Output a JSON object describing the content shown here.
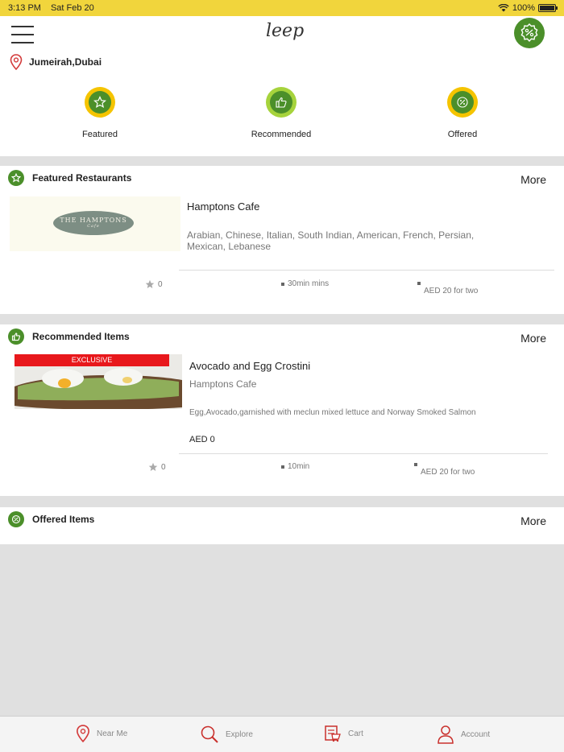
{
  "status": {
    "time": "3:13 PM",
    "date": "Sat Feb 20",
    "battery": "100%",
    "battery_level": 1.0
  },
  "app": {
    "logo": "leep"
  },
  "location": {
    "name": "Jumeirah,Dubai"
  },
  "categories": [
    {
      "label": "Featured",
      "icon": "star-icon",
      "ring": "#f5c400"
    },
    {
      "label": "Recommended",
      "icon": "thumbs-up-icon",
      "ring": "#a6d33c"
    },
    {
      "label": "Offered",
      "icon": "percent-badge-icon",
      "ring": "#f5c400"
    }
  ],
  "featured": {
    "title": "Featured Restaurants",
    "more": "More",
    "item": {
      "name": "Hamptons Cafe",
      "logo_text": "THE HAMPTONS",
      "logo_sub": "Cafe",
      "cuisines_line1": "Arabian, Chinese, Italian, South Indian, American, French, Persian,",
      "cuisines_line2": "Mexican, Lebanese",
      "rating": "0",
      "time": "30min mins",
      "price": "AED 20 for two"
    }
  },
  "recommended": {
    "title": "Recommended Items",
    "more": "More",
    "item": {
      "badge": "EXCLUSIVE",
      "name": "Avocado and Egg Crostini",
      "restaurant": "Hamptons Cafe",
      "description": "Egg,Avocado,garnished with meclun mixed lettuce and Norway Smoked Salmon",
      "price": "AED 0",
      "rating": "0",
      "time": "10min",
      "price_for_two": "AED 20 for two"
    }
  },
  "offered": {
    "title": "Offered Items",
    "more": "More"
  },
  "tabs": [
    {
      "label": "Near Me",
      "icon": "location-pin-icon"
    },
    {
      "label": "Explore",
      "icon": "search-icon"
    },
    {
      "label": "Cart",
      "icon": "cart-icon"
    },
    {
      "label": "Account",
      "icon": "user-icon"
    }
  ],
  "colors": {
    "accent": "#4b8f2a",
    "status_bar": "#f1d53c",
    "pin": "#d33a3a",
    "badge": "#e8181c"
  }
}
